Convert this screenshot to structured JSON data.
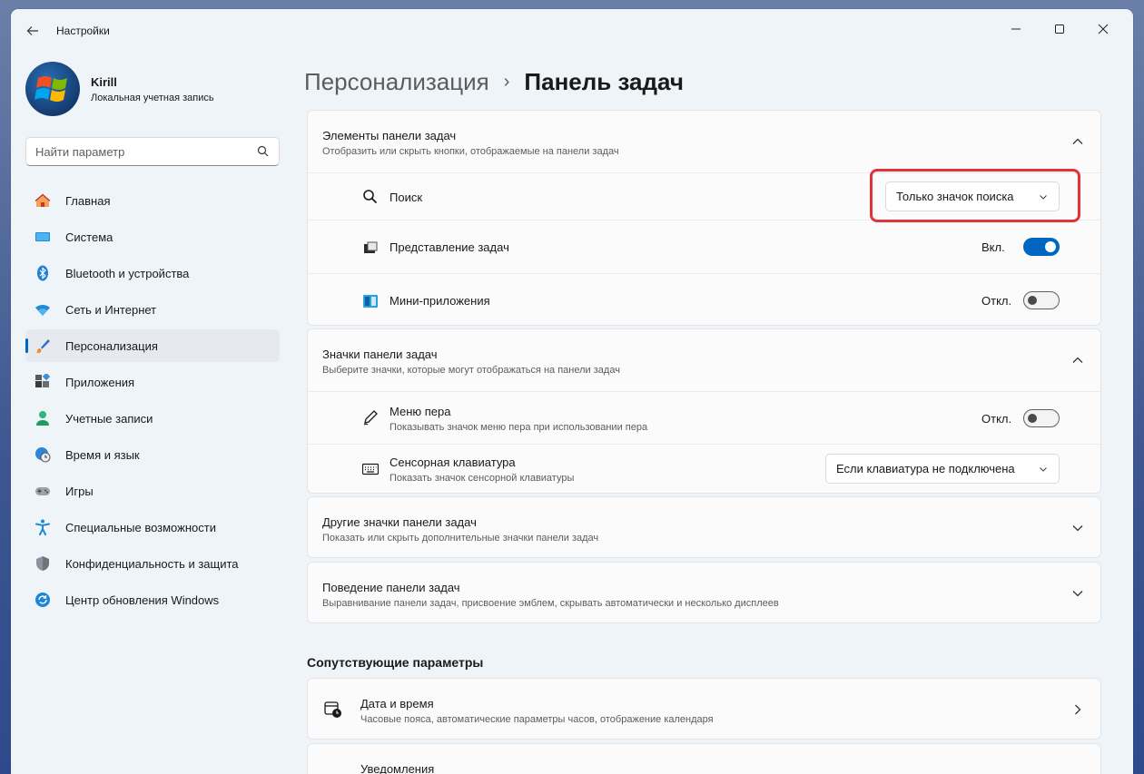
{
  "app": {
    "title": "Настройки"
  },
  "user": {
    "name": "Kirill",
    "account_type": "Локальная учетная запись"
  },
  "search": {
    "placeholder": "Найти параметр"
  },
  "sidebar": {
    "items": [
      {
        "label": "Главная",
        "icon": "home-icon"
      },
      {
        "label": "Система",
        "icon": "system-icon"
      },
      {
        "label": "Bluetooth и устройства",
        "icon": "bluetooth-icon"
      },
      {
        "label": "Сеть и Интернет",
        "icon": "wifi-icon"
      },
      {
        "label": "Персонализация",
        "icon": "brush-icon",
        "active": true
      },
      {
        "label": "Приложения",
        "icon": "apps-icon"
      },
      {
        "label": "Учетные записи",
        "icon": "account-icon"
      },
      {
        "label": "Время и язык",
        "icon": "globe-clock-icon"
      },
      {
        "label": "Игры",
        "icon": "gamepad-icon"
      },
      {
        "label": "Специальные возможности",
        "icon": "accessibility-icon"
      },
      {
        "label": "Конфиденциальность и защита",
        "icon": "shield-icon"
      },
      {
        "label": "Центр обновления Windows",
        "icon": "update-icon"
      }
    ]
  },
  "breadcrumb": {
    "parent": "Персонализация",
    "separator": "›",
    "current": "Панель задач"
  },
  "taskbar_items": {
    "title": "Элементы панели задач",
    "subtitle": "Отобразить или скрыть кнопки, отображаемые на панели задач",
    "search": {
      "label": "Поиск",
      "value": "Только значок поиска"
    },
    "task_view": {
      "label": "Представление задач",
      "state_label": "Вкл.",
      "on": true
    },
    "widgets": {
      "label": "Мини-приложения",
      "state_label": "Откл.",
      "on": false
    }
  },
  "taskbar_icons": {
    "title": "Значки панели задач",
    "subtitle": "Выберите значки, которые могут отображаться на панели задач",
    "pen_menu": {
      "label": "Меню пера",
      "desc": "Показывать значок меню пера при использовании пера",
      "state_label": "Откл.",
      "on": false
    },
    "touch_keyboard": {
      "label": "Сенсорная клавиатура",
      "desc": "Показать значок сенсорной клавиатуры",
      "value": "Если клавиатура не подключена"
    }
  },
  "other_icons": {
    "title": "Другие значки панели задач",
    "subtitle": "Показать или скрыть дополнительные значки панели задач"
  },
  "behavior": {
    "title": "Поведение панели задач",
    "subtitle": "Выравнивание панели задач, присвоение эмблем, скрывать автоматически и несколько дисплеев"
  },
  "related": {
    "heading": "Сопутствующие параметры",
    "datetime": {
      "title": "Дата и время",
      "subtitle": "Часовые пояса, автоматические параметры часов, отображение календаря"
    },
    "notifications": {
      "title": "Уведомления"
    }
  },
  "colors": {
    "accent": "#0067c0",
    "highlight": "#e0333a"
  }
}
